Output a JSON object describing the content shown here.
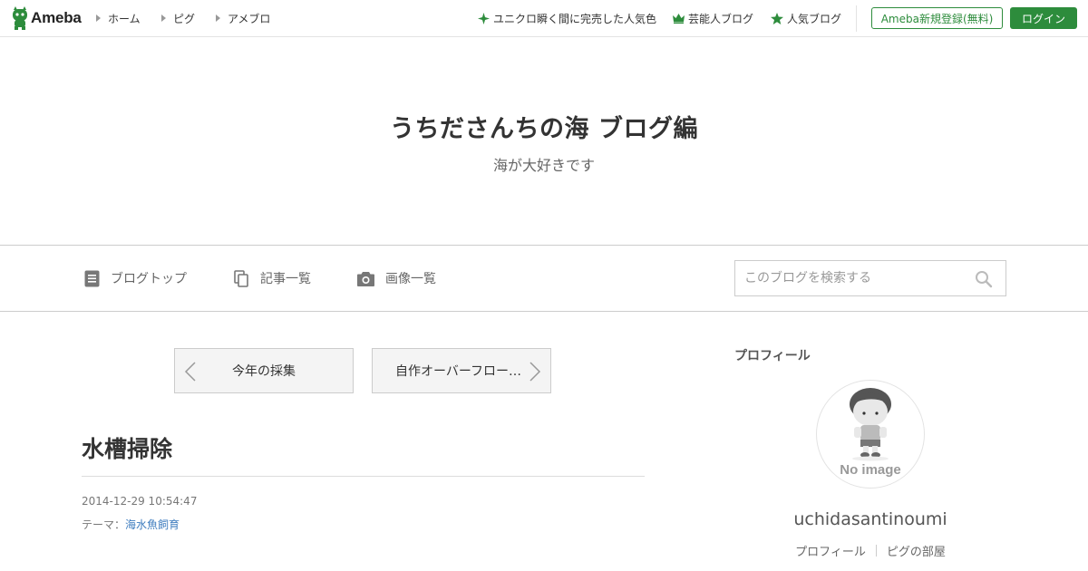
{
  "header": {
    "logo_text": "Ameba",
    "nav": [
      {
        "label": "ホーム"
      },
      {
        "label": "ピグ"
      },
      {
        "label": "アメブロ"
      }
    ],
    "links": [
      {
        "label": "ユニクロ瞬く間に完売した人気色",
        "icon": "sparkle-icon"
      },
      {
        "label": "芸能人ブログ",
        "icon": "crown-icon"
      },
      {
        "label": "人気ブログ",
        "icon": "star-icon"
      }
    ],
    "register_label": "Ameba新規登録(無料)",
    "login_label": "ログイン"
  },
  "blog": {
    "title": "うちださんちの海 ブログ編",
    "description": "海が大好きです"
  },
  "blog_nav": {
    "items": [
      {
        "label": "ブログトップ",
        "icon": "document-icon"
      },
      {
        "label": "記事一覧",
        "icon": "pages-icon"
      },
      {
        "label": "画像一覧",
        "icon": "camera-icon"
      }
    ],
    "search_placeholder": "このブログを検索する"
  },
  "article": {
    "prev_label": "今年の採集",
    "next_label": "自作オーバーフロー…",
    "title": "水槽掃除",
    "date": "2014-12-29 10:54:47",
    "theme_prefix": "テーマ：",
    "theme_link": "海水魚飼育"
  },
  "sidebar": {
    "heading": "プロフィール",
    "avatar_text": "No image",
    "username": "uchidasantinoumi",
    "links": [
      {
        "label": "プロフィール"
      },
      {
        "label": "ピグの部屋"
      }
    ]
  },
  "colors": {
    "brand_green": "#2d8c3c",
    "link_blue": "#3f7dbf"
  }
}
